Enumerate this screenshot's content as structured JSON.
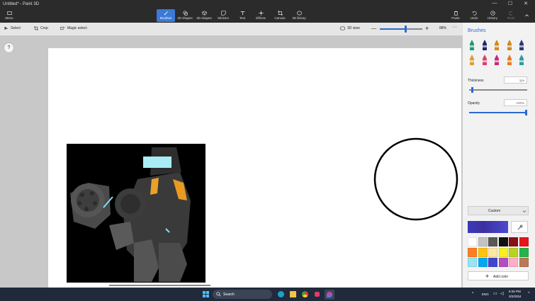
{
  "window": {
    "title": "Untitled* - Paint 3D"
  },
  "ribbon": {
    "menu_label": "Menu",
    "tools": [
      {
        "label": "Brushes",
        "icon": "brush-icon"
      },
      {
        "label": "2D shapes",
        "icon": "2d-shapes-icon"
      },
      {
        "label": "3D shapes",
        "icon": "3d-shapes-icon"
      },
      {
        "label": "Stickers",
        "icon": "stickers-icon"
      },
      {
        "label": "Text",
        "icon": "text-icon"
      },
      {
        "label": "Effects",
        "icon": "effects-icon"
      },
      {
        "label": "Canvas",
        "icon": "canvas-icon"
      },
      {
        "label": "3D library",
        "icon": "3d-library-icon"
      }
    ],
    "right_tools": [
      {
        "label": "Paste",
        "icon": "paste-icon"
      },
      {
        "label": "Undo",
        "icon": "undo-icon"
      },
      {
        "label": "History",
        "icon": "history-icon"
      },
      {
        "label": "Redo",
        "icon": "redo-icon"
      }
    ]
  },
  "toolbar": {
    "select_label": "Select",
    "crop_label": "Crop",
    "magic_select_label": "Magic select",
    "view_3d_label": "3D view",
    "zoom": "88%",
    "zoom_fraction": 0.6,
    "more": "···"
  },
  "help": "?",
  "panel": {
    "title": "Brushes",
    "thickness_label": "Thickness",
    "thickness_value": "1px",
    "thickness_fraction": 0.05,
    "opacity_label": "Opacity",
    "opacity_value": "100%",
    "opacity_fraction": 1.0,
    "color_mode": "Custom",
    "current_color": "#3a3ab8",
    "add_color_label": "Add color",
    "palette": [
      "#ffffff",
      "#c3c3c3",
      "#585858",
      "#111111",
      "#881015",
      "#e8141c",
      "#fd7f23",
      "#fdc30e",
      "#fde6a4",
      "#f7ef22",
      "#b5d423",
      "#27b24b",
      "#98e4f5",
      "#00a8f3",
      "#3f48cc",
      "#b24ec2",
      "#ffaec8",
      "#b97a56"
    ],
    "brushes": [
      "marker-icon",
      "calligraphy-pen-icon",
      "oil-brush-icon",
      "watercolor-icon",
      "pencil-icon",
      "eraser-icon",
      "crayon-icon",
      "pixel-pen-icon",
      "spray-can-icon",
      "fill-icon"
    ]
  },
  "taskbar": {
    "search_label": "Search",
    "lang": "ENG",
    "time": "8:25 PM",
    "date": "3/2/2024"
  }
}
